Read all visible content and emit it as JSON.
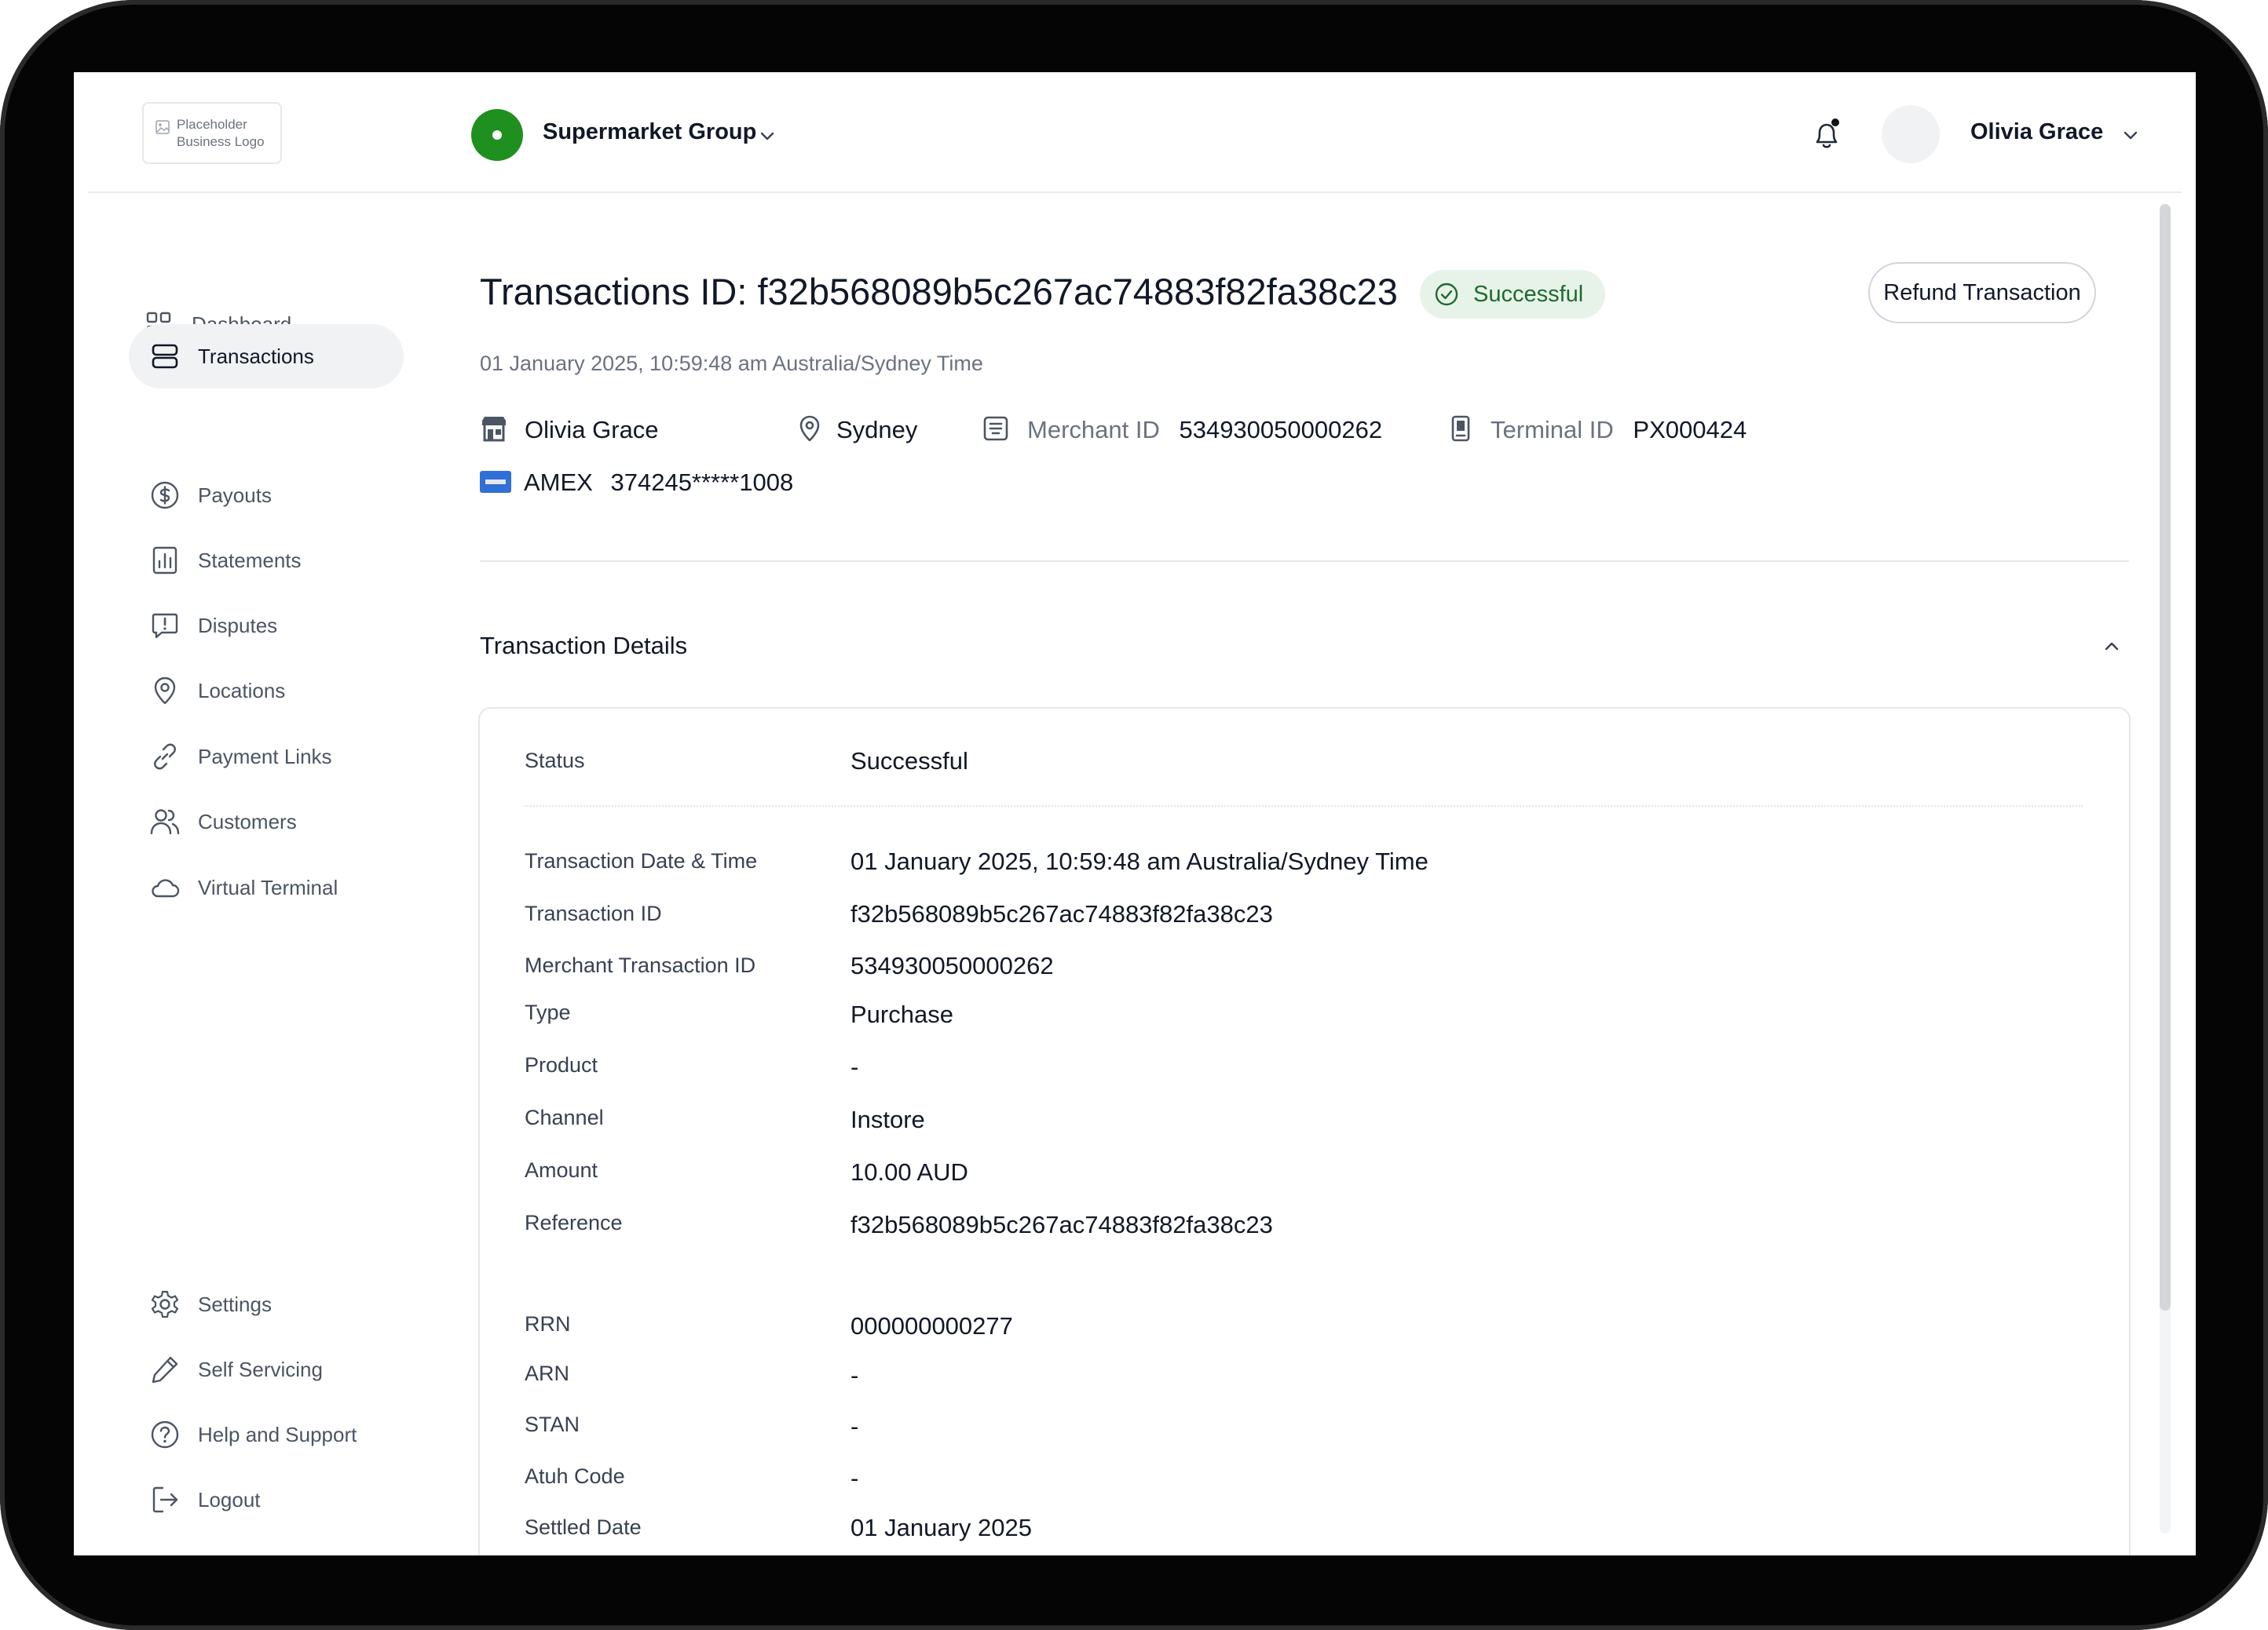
{
  "header": {
    "logo_text": "Placeholder\nBusiness Logo",
    "org_name": "Supermarket Group",
    "user_name": "Olivia Grace",
    "brand_color": "#1f8f1f"
  },
  "sidebar": {
    "items": [
      {
        "label": "Dashboard",
        "icon": "grid-icon"
      },
      {
        "label": "Transactions",
        "icon": "database-icon",
        "active": true
      },
      {
        "label": "Payouts",
        "icon": "dollar-circle-icon"
      },
      {
        "label": "Statements",
        "icon": "bar-chart-icon"
      },
      {
        "label": "Disputes",
        "icon": "alert-message-icon"
      },
      {
        "label": "Locations",
        "icon": "map-pin-icon"
      },
      {
        "label": "Payment Links",
        "icon": "link-icon"
      },
      {
        "label": "Customers",
        "icon": "users-icon"
      },
      {
        "label": "Virtual Terminal",
        "icon": "cloud-icon"
      }
    ],
    "bottom_items": [
      {
        "label": "Settings",
        "icon": "gear-icon"
      },
      {
        "label": "Self Servicing",
        "icon": "pencil-icon"
      },
      {
        "label": "Help and Support",
        "icon": "help-circle-icon"
      },
      {
        "label": "Logout",
        "icon": "logout-icon"
      }
    ]
  },
  "main": {
    "title": "Transactions ID: f32b568089b5c267ac74883f82fa38c23",
    "status_badge": "Successful",
    "refund_label": "Refund Transaction",
    "date_line": "01 January 2025, 10:59:48 am Australia/Sydney Time",
    "meta": {
      "customer": "Olivia Grace",
      "location": "Sydney",
      "merchant_label": "Merchant ID",
      "merchant_id": "534930050000262",
      "terminal_label": "Terminal ID",
      "terminal_id": "PX000424",
      "card_brand": "AMEX",
      "card_number": "374245*****1008"
    },
    "section_title": "Transaction Details",
    "details": [
      {
        "label": "Status",
        "value": "Successful"
      },
      {
        "label": "Transaction Date & Time",
        "value": "01 January 2025, 10:59:48 am Australia/Sydney Time"
      },
      {
        "label": "Transaction ID",
        "value": "f32b568089b5c267ac74883f82fa38c23"
      },
      {
        "label": "Merchant Transaction ID",
        "value": "534930050000262"
      },
      {
        "label": "Type",
        "value": "Purchase"
      },
      {
        "label": "Product",
        "value": "-"
      },
      {
        "label": "Channel",
        "value": "Instore"
      },
      {
        "label": "Amount",
        "value": "10.00 AUD"
      },
      {
        "label": "Reference",
        "value": "f32b568089b5c267ac74883f82fa38c23"
      },
      {
        "label": "RRN",
        "value": "000000000277"
      },
      {
        "label": "ARN",
        "value": "-"
      },
      {
        "label": "STAN",
        "value": "-"
      },
      {
        "label": "Atuh Code",
        "value": "-"
      },
      {
        "label": "Settled Date",
        "value": "01 January 2025"
      }
    ]
  },
  "colors": {
    "success_bg": "#e7f3e9",
    "success_text": "#1e6b2d",
    "amex_blue": "#2f6fd6"
  }
}
